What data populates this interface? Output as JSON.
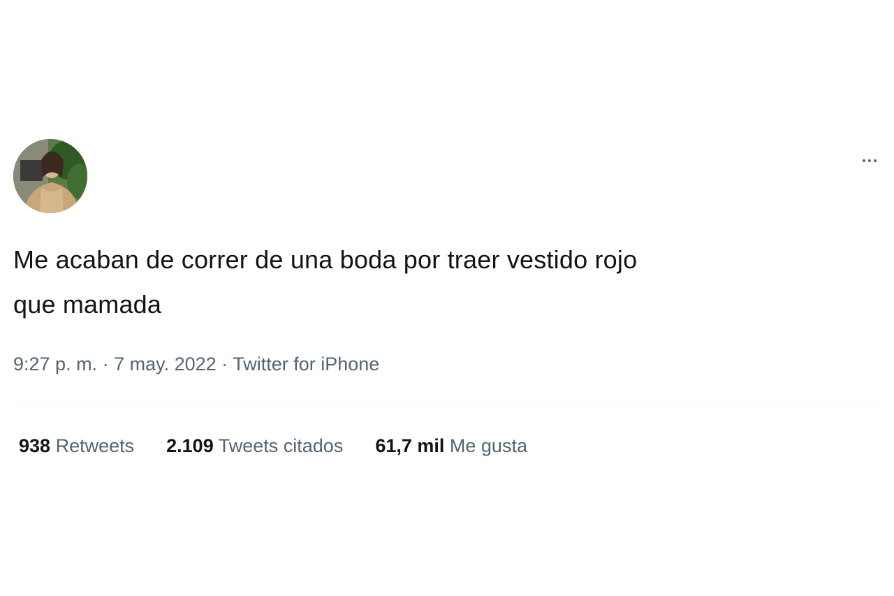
{
  "tweet": {
    "avatar_icon": "user-avatar-photo",
    "more_icon": "more-horizontal-icon",
    "text_line1": "Me acaban de correr de una boda por traer vestido rojo",
    "text_line2": "que mamada",
    "time": "9:27 p. m.",
    "separator": " · ",
    "date": "7 may. 2022",
    "source": "Twitter for iPhone"
  },
  "stats": {
    "retweets": {
      "count": "938",
      "label": "Retweets"
    },
    "quotes": {
      "count": "2.109",
      "label": "Tweets citados"
    },
    "likes": {
      "count": "61,7 mil",
      "label": "Me gusta"
    }
  },
  "colors": {
    "text": "#0f1419",
    "secondary": "#536471",
    "divider": "#eff3f4",
    "background": "#ffffff"
  }
}
